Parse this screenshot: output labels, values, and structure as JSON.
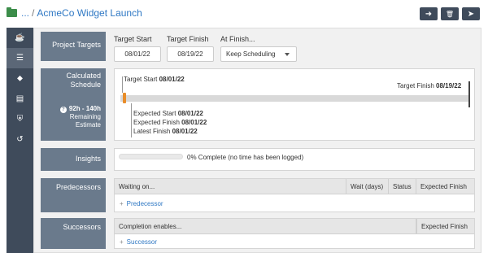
{
  "header": {
    "crumb_prefix": "...",
    "separator": "/",
    "title": "AcmeCo Widget Launch",
    "buttons": [
      {
        "name": "next-button",
        "glyph": "➜"
      },
      {
        "name": "delete-button",
        "glyph": "🗑"
      },
      {
        "name": "send-button",
        "glyph": "➤"
      }
    ]
  },
  "sidebar": {
    "items": [
      {
        "icon": "cup-icon",
        "glyph": "☕"
      },
      {
        "icon": "menu-icon",
        "glyph": "☰"
      },
      {
        "icon": "tag-icon",
        "glyph": "⬥"
      },
      {
        "icon": "note-icon",
        "glyph": "▤"
      },
      {
        "icon": "shield-icon",
        "glyph": "⛨"
      },
      {
        "icon": "history-icon",
        "glyph": "↺"
      }
    ]
  },
  "targets": {
    "section_label": "Project Targets",
    "start_label": "Target Start",
    "start_value": "08/01/22",
    "finish_label": "Target Finish",
    "finish_value": "08/19/22",
    "at_finish_label": "At Finish...",
    "at_finish_value": "Keep Scheduling"
  },
  "schedule": {
    "section_label": "Calculated Schedule",
    "estimate_hours": "92h - 140h",
    "estimate_line1": "Remaining",
    "estimate_line2": "Estimate",
    "target_start_label": "Target Start",
    "target_start_value": "08/01/22",
    "target_finish_label": "Target Finish",
    "target_finish_value": "08/19/22",
    "expected_start_label": "Expected Start",
    "expected_start_value": "08/01/22",
    "expected_finish_label": "Expected Finish",
    "expected_finish_value": "08/01/22",
    "latest_finish_label": "Latest Finish",
    "latest_finish_value": "08/01/22"
  },
  "insights": {
    "section_label": "Insights",
    "progress_percent": 0,
    "progress_text": "0% Complete (no time has been logged)"
  },
  "predecessors": {
    "section_label": "Predecessors",
    "columns": [
      "Waiting on...",
      "Wait (days)",
      "Status",
      "Expected Finish"
    ],
    "add_label": "Predecessor"
  },
  "successors": {
    "section_label": "Successors",
    "columns": [
      "Completion enables...",
      "Expected Finish"
    ],
    "add_label": "Successor"
  },
  "colors": {
    "accent": "#2f78c4",
    "sidebar": "#3f4b5b",
    "section_label": "#6a7a8c",
    "marker": "#e88d2a",
    "folder": "#3c8d4a"
  }
}
